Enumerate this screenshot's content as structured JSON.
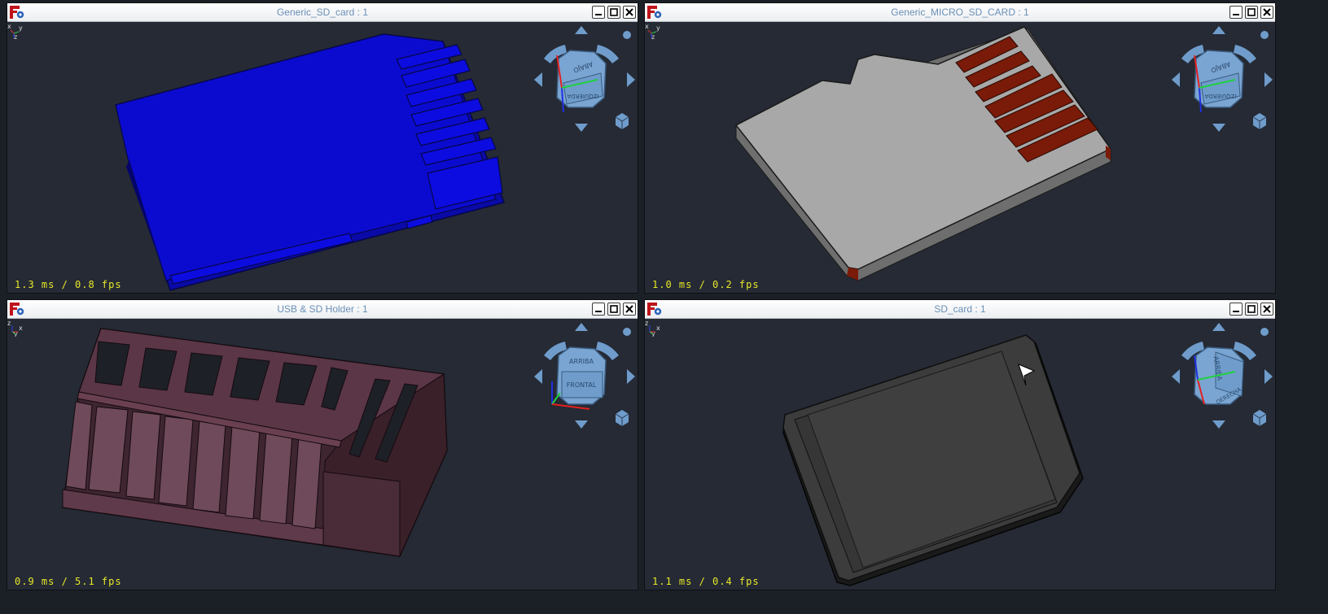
{
  "colors": {
    "viewport_bg": "#252a34",
    "title_text": "#6a8fb7",
    "fps_text": "#e8e82a",
    "navcube": "#6f9ccb",
    "sd_card_blue": "#0b0bd0",
    "micro_sd_gray": "#a6a6a6",
    "micro_sd_contacts": "#7a1a08",
    "holder_mauve": "#5f3a4a",
    "sd_card_dark": "#3a3a3a"
  },
  "windows": [
    {
      "title": "Generic_SD_card : 1",
      "fps": "1.3 ms / 0.8 fps",
      "navcube": {
        "top": "ABAJO",
        "front": "IZQUIERDA"
      },
      "axis_labels": [
        "x",
        "y",
        "z"
      ]
    },
    {
      "title": "Generic_MICRO_SD_CARD : 1",
      "fps": "1.0 ms / 0.2 fps",
      "navcube": {
        "top": "ABAJO",
        "front": "IZQUIERDA"
      },
      "axis_labels": [
        "x",
        "y",
        "z"
      ]
    },
    {
      "title": "USB & SD Holder : 1",
      "fps": "0.9 ms / 5.1 fps",
      "navcube": {
        "top": "ARRIBA",
        "front": "FRONTAL"
      },
      "axis_labels": [
        "z",
        "x",
        "y"
      ]
    },
    {
      "title": "SD_card : 1",
      "fps": "1.1 ms / 0.4 fps",
      "navcube": {
        "top": "ARRIBA",
        "front": "DERECHA"
      },
      "axis_labels": [
        "z",
        "x",
        "y"
      ]
    }
  ],
  "icons": {
    "app_logo": "freecad-logo-icon",
    "minimize": "minimize-icon",
    "maximize": "maximize-icon",
    "close": "close-icon",
    "nav_rotate": "rotate-arrow-icon",
    "nav_pan": "triangle-arrow-icon",
    "nav_menu": "small-cube-icon"
  }
}
